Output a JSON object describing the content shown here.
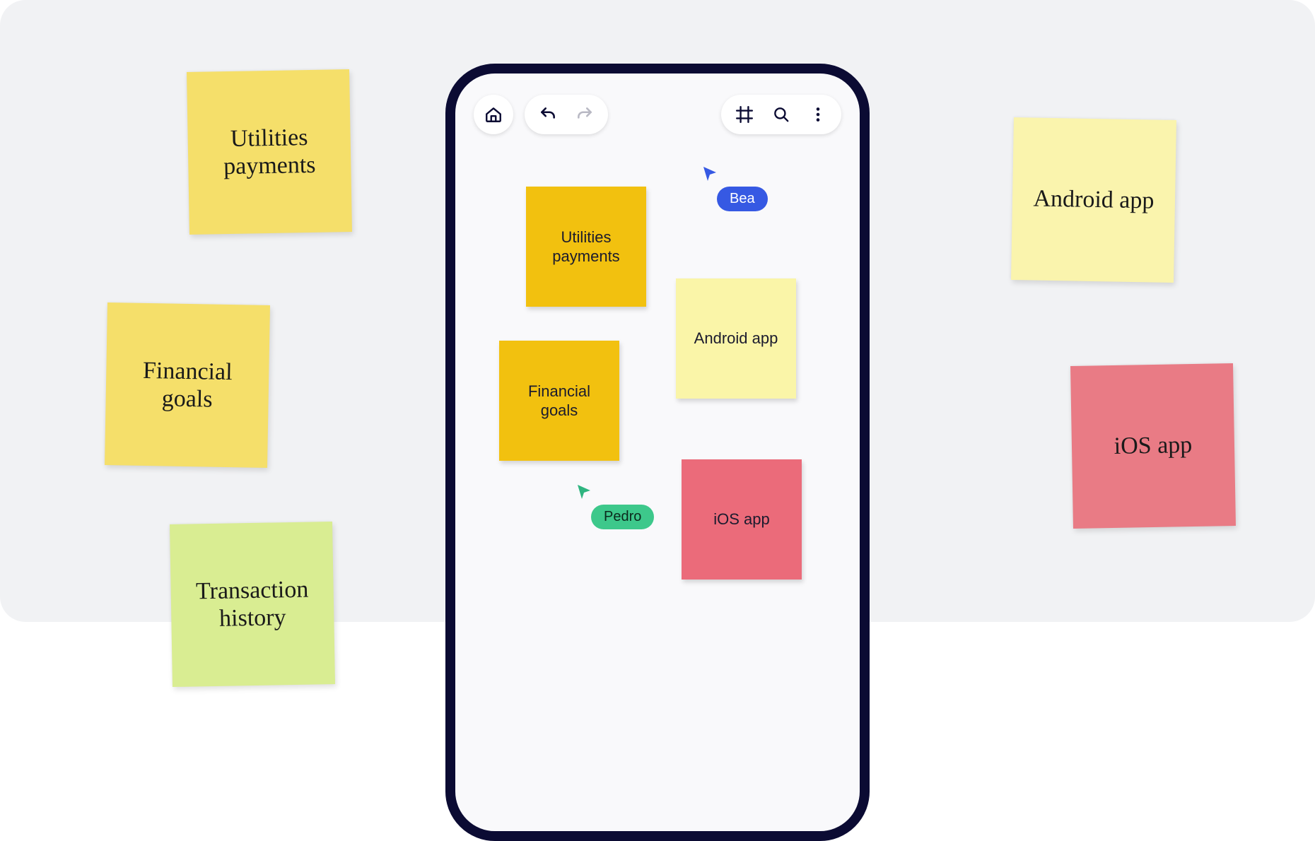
{
  "background_notes": {
    "utilities_payments": "Utilities payments",
    "financial_goals": "Financial goals",
    "transaction_history": "Transaction history",
    "android_app": "Android app",
    "ios_app": "iOS app"
  },
  "phone": {
    "toolbar": {
      "home_icon": "home-icon",
      "undo_icon": "undo-icon",
      "redo_icon": "redo-icon",
      "frame_icon": "frame-icon",
      "search_icon": "search-icon",
      "more_icon": "more-vertical-icon"
    },
    "notes": {
      "utilities_payments": "Utilities payments",
      "financial_goals": "Financial goals",
      "android_app": "Android app",
      "ios_app": "iOS app"
    },
    "cursors": {
      "bea": "Bea",
      "pedro": "Pedro"
    }
  },
  "colors": {
    "frame": "#0b0b33",
    "amber": "#f2c10f",
    "pale_yellow": "#faf5a8",
    "pink": "#eb6b7a",
    "cursor_blue": "#3659e3",
    "cursor_green": "#3dc88b"
  }
}
